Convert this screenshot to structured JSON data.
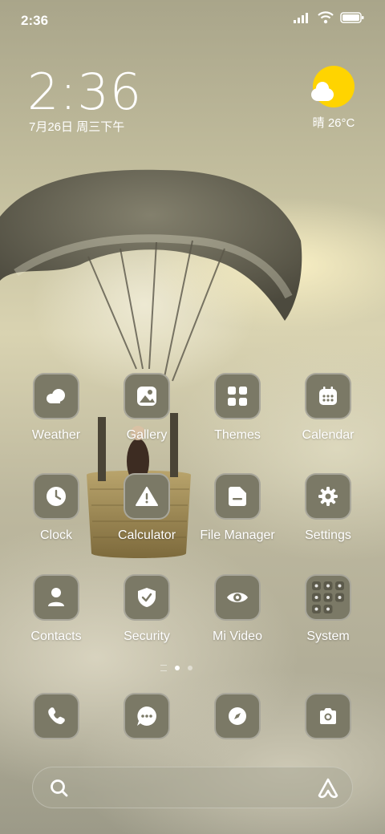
{
  "status_bar": {
    "time": "2:36"
  },
  "lock": {
    "time": "2:36",
    "date": "7月26日 周三下午"
  },
  "weather": {
    "text": "晴 26°C"
  },
  "apps": [
    {
      "label": "Weather",
      "icon": "weather-icon"
    },
    {
      "label": "Gallery",
      "icon": "gallery-icon"
    },
    {
      "label": "Themes",
      "icon": "themes-icon"
    },
    {
      "label": "Calendar",
      "icon": "calendar-icon"
    },
    {
      "label": "Clock",
      "icon": "clock-icon"
    },
    {
      "label": "Calculator",
      "icon": "warning-icon"
    },
    {
      "label": "File Manager",
      "icon": "file-manager-icon"
    },
    {
      "label": "Settings",
      "icon": "gear-icon"
    },
    {
      "label": "Contacts",
      "icon": "contacts-icon"
    },
    {
      "label": "Security",
      "icon": "shield-icon"
    },
    {
      "label": "Mi Video",
      "icon": "eye-icon"
    },
    {
      "label": "System",
      "icon": "folder-icon"
    }
  ],
  "page_indicator": {
    "pages": 2,
    "current": 1
  },
  "dock": [
    {
      "icon": "phone-icon"
    },
    {
      "icon": "messages-icon"
    },
    {
      "icon": "compass-icon"
    },
    {
      "icon": "camera-icon"
    }
  ],
  "colors": {
    "tile": "#7b7966",
    "sun": "#ffd400"
  }
}
